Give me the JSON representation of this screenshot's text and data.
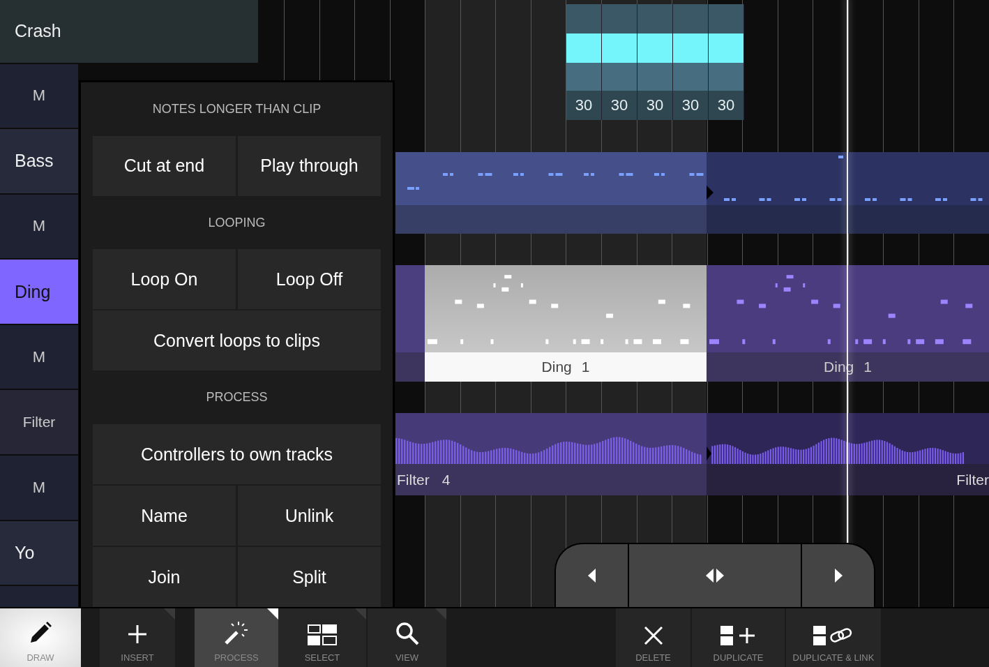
{
  "tracks": [
    {
      "kind": "wide",
      "label": "Crash",
      "selected": false
    },
    {
      "kind": "mute",
      "label": "M"
    },
    {
      "kind": "name",
      "label": "Bass",
      "selected": false
    },
    {
      "kind": "mute",
      "label": "M"
    },
    {
      "kind": "name",
      "label": "Ding",
      "selected": true
    },
    {
      "kind": "mute",
      "label": "M"
    },
    {
      "kind": "centered",
      "label": "Filter",
      "selected": false
    },
    {
      "kind": "mute",
      "label": "M"
    },
    {
      "kind": "name",
      "label": "Yo",
      "selected": false
    },
    {
      "kind": "empty"
    }
  ],
  "crash_clip": {
    "cells": [
      "30",
      "30",
      "30",
      "30",
      "30"
    ]
  },
  "ding_clips": [
    {
      "name": "Ding",
      "number": "1",
      "selected": true
    },
    {
      "name": "Ding",
      "number": "1",
      "selected": false
    }
  ],
  "filter_clips": [
    {
      "name": "Filter",
      "number": "4"
    },
    {
      "name": "Filter"
    }
  ],
  "menu": {
    "sections": [
      {
        "heading": "NOTES LONGER THAN CLIP",
        "rows": [
          [
            "Cut at end",
            "Play through"
          ]
        ]
      },
      {
        "heading": "LOOPING",
        "rows": [
          [
            "Loop On",
            "Loop Off"
          ],
          [
            "Convert loops to clips"
          ]
        ]
      },
      {
        "heading": "PROCESS",
        "rows": [
          [
            "Controllers to own tracks"
          ],
          [
            "Name",
            "Unlink"
          ],
          [
            "Join",
            "Split"
          ]
        ]
      }
    ]
  },
  "nav_buttons": [
    {
      "kind": "left"
    },
    {
      "kind": "both"
    },
    {
      "kind": "right"
    }
  ],
  "toolbar": [
    {
      "kind": "pencil",
      "label": "DRAW",
      "selected": true,
      "menu_open": false,
      "has_options": false
    },
    {
      "kind": "plus",
      "label": "INSERT",
      "selected": false,
      "menu_open": false,
      "has_options": true
    },
    {
      "kind": "wand",
      "label": "PROCESS",
      "selected": false,
      "menu_open": true,
      "has_options": true
    },
    {
      "kind": "select",
      "label": "SELECT",
      "selected": false,
      "menu_open": false,
      "has_options": true
    },
    {
      "kind": "search",
      "label": "VIEW",
      "selected": false,
      "menu_open": false,
      "has_options": true
    },
    {
      "kind": "x",
      "label": "DELETE",
      "selected": false,
      "menu_open": false,
      "has_options": false
    },
    {
      "kind": "dup",
      "label": "DUPLICATE",
      "selected": false,
      "menu_open": false,
      "has_options": false
    },
    {
      "kind": "duplink",
      "label": "DUPLICATE & LINK",
      "selected": false,
      "menu_open": false,
      "has_options": false
    }
  ]
}
